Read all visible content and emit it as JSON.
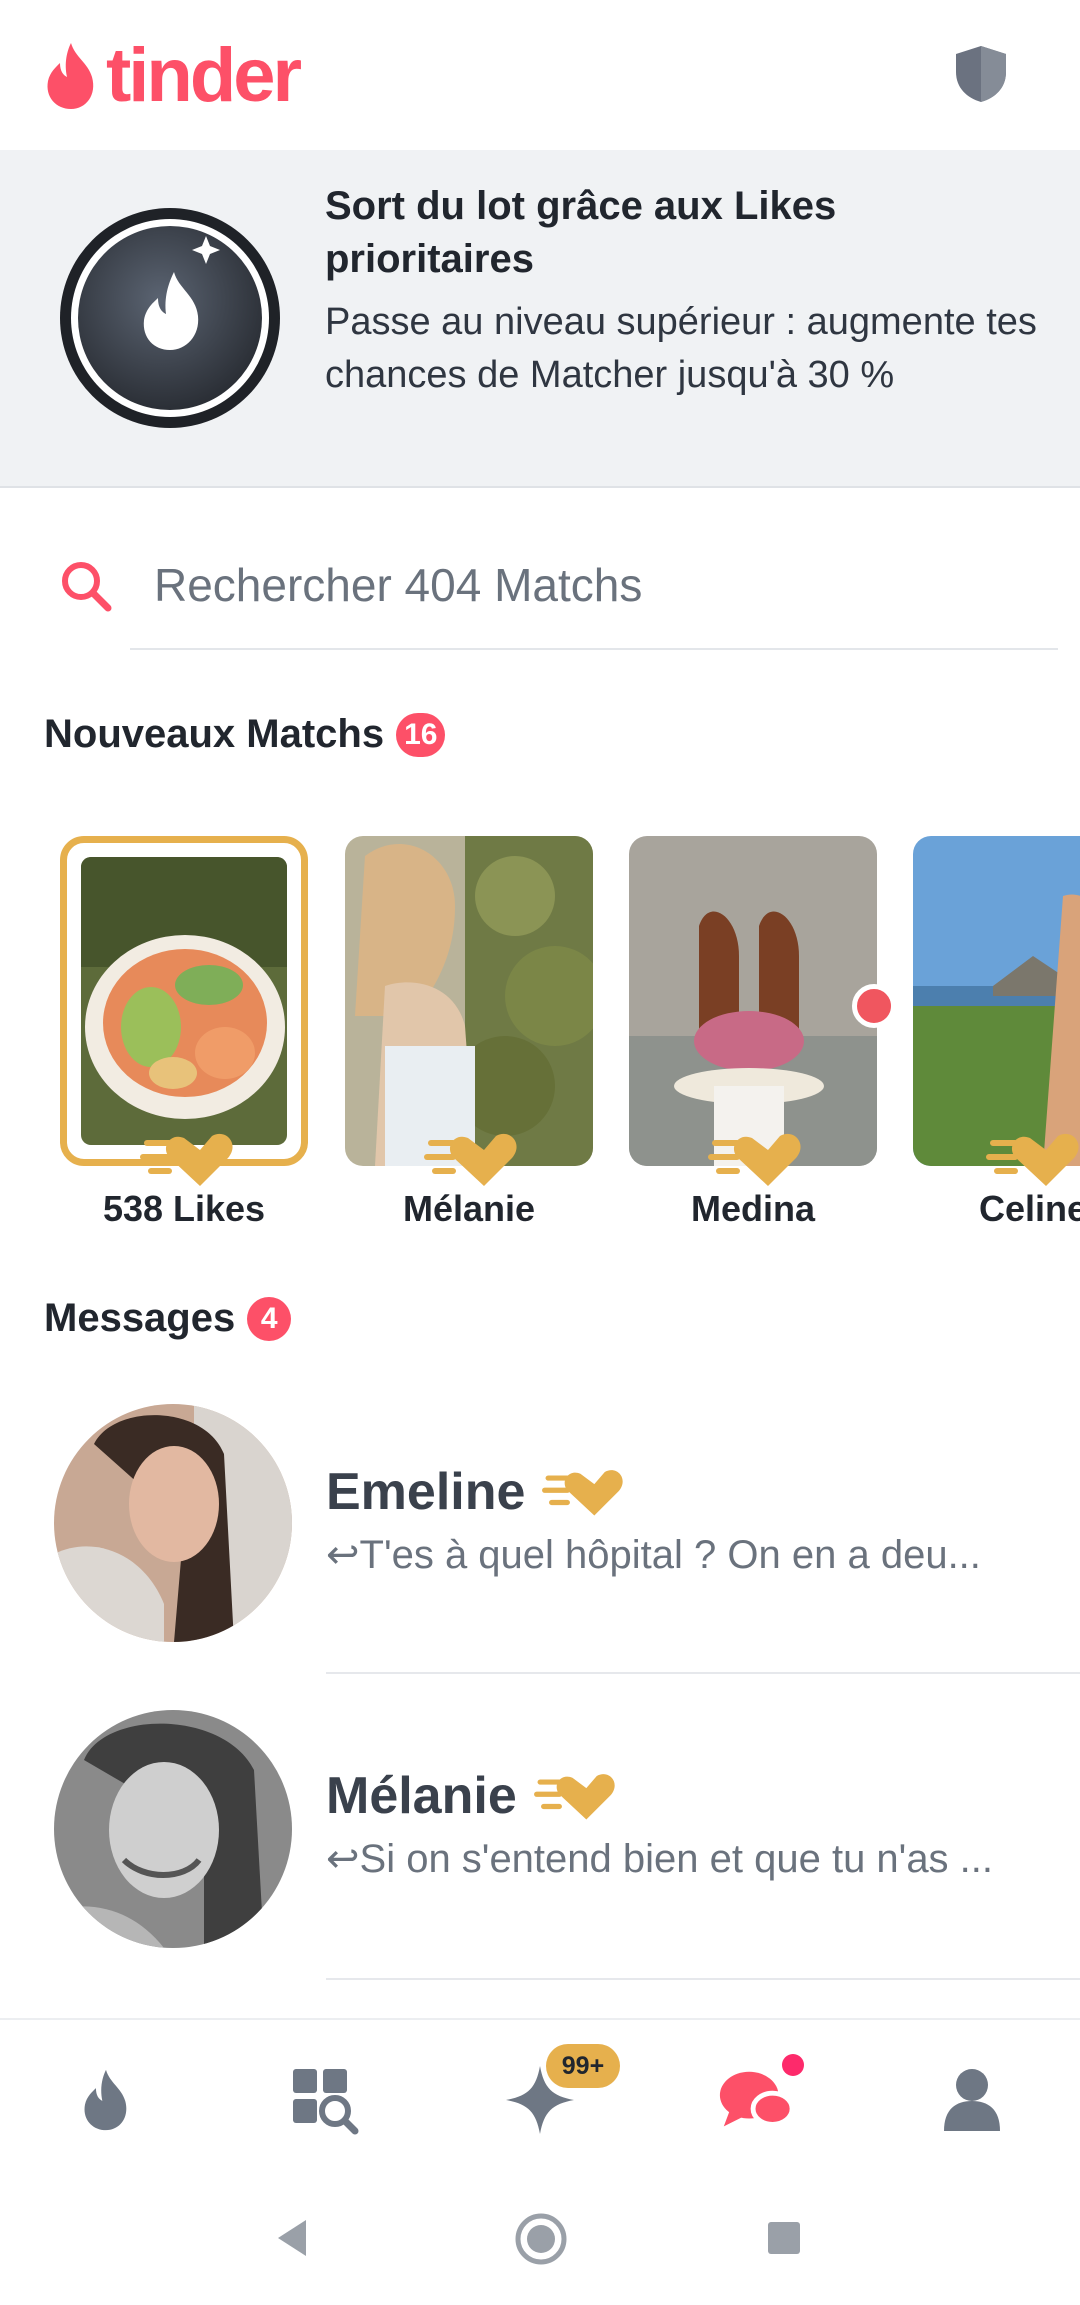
{
  "header": {
    "logo_text": "tinder",
    "safety_icon": "shield-icon"
  },
  "promo": {
    "title": "Sort du lot grâce aux Likes prioritaires",
    "subtitle": "Passe au niveau supérieur : augmente tes chances de Matcher jusqu'à 30 %"
  },
  "search": {
    "placeholder": "Rechercher 404 Matchs",
    "value": ""
  },
  "new_matches": {
    "title": "Nouveaux Matchs",
    "count": "16",
    "items": [
      {
        "name": "538 Likes"
      },
      {
        "name": "Mélanie"
      },
      {
        "name": "Medina"
      },
      {
        "name": "Celine"
      }
    ]
  },
  "messages": {
    "title": "Messages",
    "count": "4",
    "items": [
      {
        "name": "Emeline",
        "preview": "↩T'es à quel hôpital ? On en a deu..."
      },
      {
        "name": "Mélanie",
        "preview": "↩Si on s'entend bien et que tu n'as ..."
      }
    ]
  },
  "nav": {
    "items": [
      "flame-icon",
      "explore-icon",
      "spark-icon",
      "chat-icon",
      "profile-icon"
    ],
    "spark_badge": "99+"
  },
  "colors": {
    "brand": "#fd5068",
    "gold": "#e6b04d",
    "text": "#21262e"
  }
}
